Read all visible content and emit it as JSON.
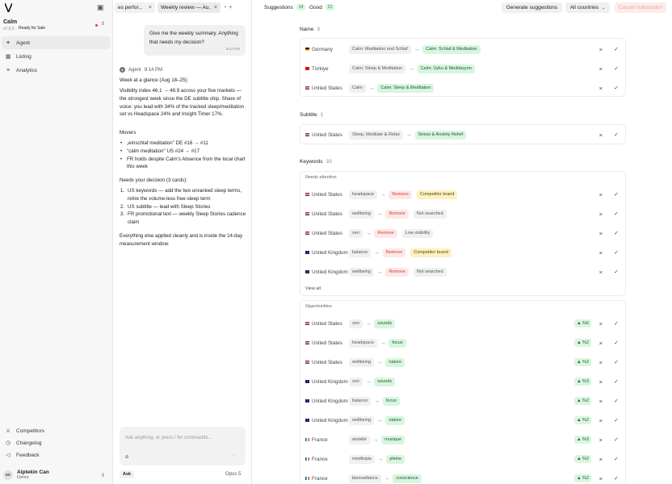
{
  "app": {
    "name": "Calm",
    "version": "v7.0.5",
    "status": "Ready for Sale"
  },
  "nav": [
    {
      "label": "Agent",
      "icon": "sparkle-icon",
      "active": true
    },
    {
      "label": "Listing",
      "icon": "grid-icon"
    },
    {
      "label": "Analytics",
      "icon": "filter-icon"
    }
  ],
  "footer": [
    {
      "label": "Competitors",
      "icon": "swords-icon"
    },
    {
      "label": "Changelog",
      "icon": "clock-icon"
    },
    {
      "label": "Feedback",
      "icon": "megaphone-icon"
    }
  ],
  "user": {
    "initials": "AC",
    "name": "Alptekin Can",
    "role": "Demo"
  },
  "tabs": [
    {
      "label": "es perfor..."
    },
    {
      "label": "Weekly review — Au..."
    }
  ],
  "chat": {
    "user_msg": "Give me the weekly summary. Anything that needs my decision?",
    "user_time": "9:13 PM",
    "agent_name": "Agent",
    "agent_time": "9:14 PM",
    "p1": "Week at a glance (Aug 18–25):",
    "p2": "Visibility index 46.1 → 48.9 across your five markets — the strongest week since the DE subtitle ship. Share of voice: you lead with 34% of the tracked sleep/meditation set vs Headspace 24% and Insight Timer 17%.",
    "p3": "Movers",
    "movers": [
      "„einschlaf meditation\" DE #16 → #11",
      "\"calm meditation\" US #24 → #17",
      "FR holds despite Calm's Absence from the local chart this week"
    ],
    "p4": "Needs your decision (3 cards):",
    "decisions": [
      "US keywords — add the two unranked sleep terms, retire the volume-less free-sleep term",
      "US subtitle — lead with Sleep Stories",
      "FR promotional text — weekly Sleep Stories cadence claim"
    ],
    "p5": "Everything else applied cleanly and is inside the 14-day measurement window.",
    "placeholder": "Ask anything, or press / for commands...",
    "mode": "Ask",
    "model": "Opus 5"
  },
  "topbar": {
    "suggestions_label": "Suggestions",
    "suggestions_count": "14",
    "good_label": "Good",
    "good_count": "21",
    "generate": "Generate suggestions",
    "countries": "All countries",
    "cancel": "Cancel submission"
  },
  "name_section": {
    "title": "Name",
    "count": "3",
    "rows": [
      {
        "country": "Germany",
        "flag": "de",
        "old": "Calm: Meditation und Schlaf",
        "new": "Calm: Schlaf & Meditation"
      },
      {
        "country": "Türkiye",
        "flag": "tr",
        "old": "Calm: Sleep & Meditation",
        "new": "Calm: Uyku & Meditasyon"
      },
      {
        "country": "United States",
        "flag": "us",
        "old": "Calm",
        "new": "Calm: Sleep & Meditation"
      }
    ]
  },
  "subtitle_section": {
    "title": "Subtitle",
    "count": "1",
    "rows": [
      {
        "country": "United States",
        "flag": "us",
        "old": "Sleep, Meditate & Relax",
        "new": "Stress & Anxiety Relief"
      }
    ]
  },
  "keywords_section": {
    "title": "Keywords",
    "count": "33",
    "needs_attention": "Needs attention",
    "attention_rows": [
      {
        "country": "United States",
        "flag": "us",
        "kw": "headspace",
        "action": "Remove",
        "reason": "Competitor brand",
        "reason_style": "warn"
      },
      {
        "country": "United States",
        "flag": "us",
        "kw": "wellbeing",
        "action": "Remove",
        "reason": "Not searched",
        "reason_style": "gray"
      },
      {
        "country": "United States",
        "flag": "us",
        "kw": "zen",
        "action": "Remove",
        "reason": "Low visibility",
        "reason_style": "gray"
      },
      {
        "country": "United Kingdom",
        "flag": "gb",
        "kw": "balance",
        "action": "Remove",
        "reason": "Competitor brand",
        "reason_style": "warn"
      },
      {
        "country": "United Kingdom",
        "flag": "gb",
        "kw": "wellbeing",
        "action": "Remove",
        "reason": "Not searched",
        "reason_style": "gray"
      }
    ],
    "view_all": "View all",
    "opportunities": "Opportunities",
    "opp_rows": [
      {
        "country": "United States",
        "flag": "us",
        "old": "zen",
        "new": "sounds",
        "delta": "▲ %6"
      },
      {
        "country": "United States",
        "flag": "us",
        "old": "headspace",
        "new": "focus",
        "delta": "▲ %2"
      },
      {
        "country": "United States",
        "flag": "us",
        "old": "wellbeing",
        "new": "nature",
        "delta": "▲ %2"
      },
      {
        "country": "United Kingdom",
        "flag": "gb",
        "old": "zen",
        "new": "sounds",
        "delta": "▲ %3"
      },
      {
        "country": "United Kingdom",
        "flag": "gb",
        "old": "balance",
        "new": "focus",
        "delta": "▲ %2"
      },
      {
        "country": "United Kingdom",
        "flag": "gb",
        "old": "wellbeing",
        "new": "nature",
        "delta": "▲ %2"
      },
      {
        "country": "France",
        "flag": "fr",
        "old": "anxiété",
        "new": "musique",
        "delta": "▲ %3"
      },
      {
        "country": "France",
        "flag": "fr",
        "old": "meditopia",
        "new": "pleine",
        "delta": "▲ %2"
      },
      {
        "country": "France",
        "flag": "fr",
        "old": "bienveillance",
        "new": "conscience",
        "delta": "▲ %2"
      }
    ]
  },
  "colors": {
    "accent_green": "#d9f5df",
    "remove_red": "#fde8e7",
    "warn_yellow": "#fdf0c3"
  }
}
